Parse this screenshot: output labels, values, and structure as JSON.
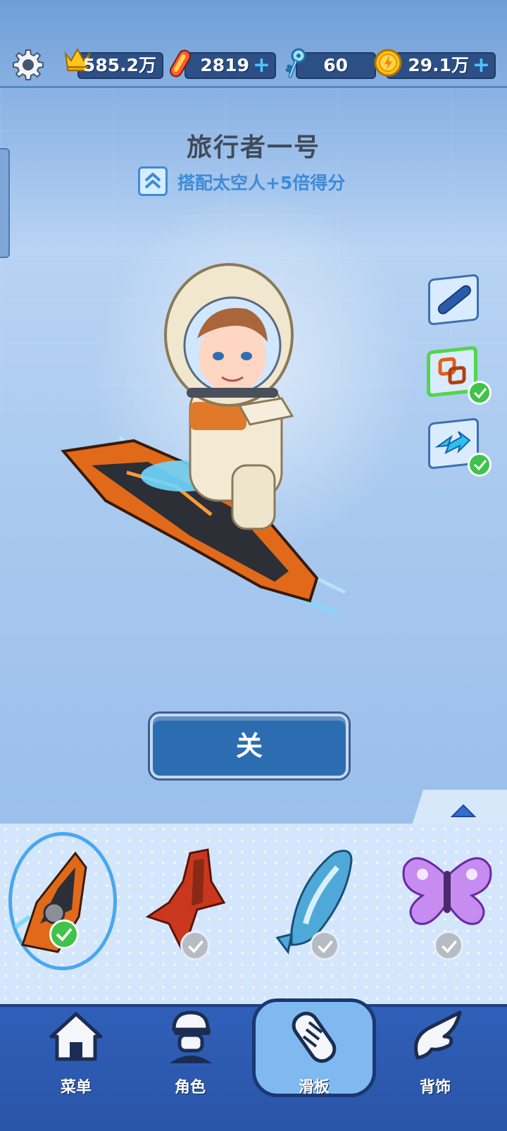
{
  "resources": {
    "crown": {
      "value": "585.2万",
      "icon": "crown-icon"
    },
    "boards": {
      "value": "2819",
      "icon": "hoverboard-token-icon",
      "plus": "+"
    },
    "keys": {
      "value": "60",
      "icon": "key-icon"
    },
    "coins": {
      "value": "29.1万",
      "icon": "coin-icon",
      "plus": "+"
    }
  },
  "board": {
    "name": "旅行者一号",
    "bonus": "搭配太空人+5倍得分"
  },
  "side_buttons": [
    {
      "name": "board-style",
      "icon": "board-icon",
      "selected": false
    },
    {
      "name": "link",
      "icon": "chain-link-icon",
      "selected": true
    },
    {
      "name": "boost",
      "icon": "arrow-boost-icon",
      "selected": true
    }
  ],
  "close_button": "关",
  "boards_list": [
    {
      "name": "voyager-board",
      "owned": true,
      "equipped": true
    },
    {
      "name": "red-bird-board",
      "owned": true,
      "equipped": false
    },
    {
      "name": "whale-board",
      "owned": true,
      "equipped": false
    },
    {
      "name": "butterfly-board",
      "owned": true,
      "equipped": false
    }
  ],
  "nav": [
    {
      "label": "菜单",
      "icon": "home-icon",
      "active": false
    },
    {
      "label": "角色",
      "icon": "character-icon",
      "active": false
    },
    {
      "label": "滑板",
      "icon": "skateboard-icon",
      "active": true
    },
    {
      "label": "背饰",
      "icon": "wings-icon",
      "active": false
    }
  ],
  "colors": {
    "accent_blue": "#2c6db2",
    "check_green": "#3fc34a",
    "bonus_blue": "#3f8ad6",
    "nav_bg": "#2f5fb8"
  }
}
